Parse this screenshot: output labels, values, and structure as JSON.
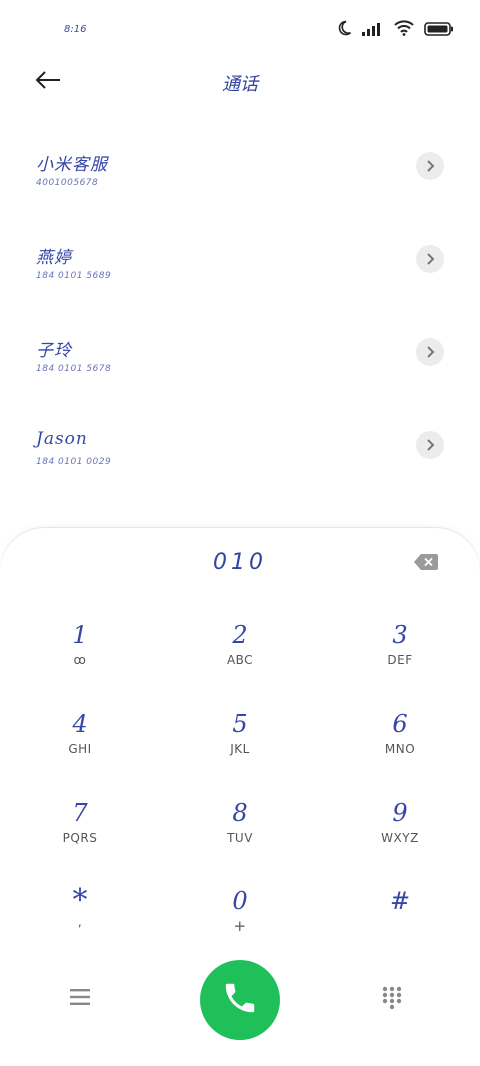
{
  "status_bar": {
    "time": "8:16"
  },
  "header": {
    "title": "通话"
  },
  "contacts": [
    {
      "name": "小米客服",
      "number": "4001005678"
    },
    {
      "name": "燕婷",
      "number": "184 0101 5689"
    },
    {
      "name": "子玲",
      "number": "184 0101 5678"
    },
    {
      "name": "Jason",
      "number": "184 0101 0029"
    }
  ],
  "dialpad": {
    "display": "010",
    "keys": [
      {
        "digit": "1",
        "letters": "ꝏ"
      },
      {
        "digit": "2",
        "letters": "ABC"
      },
      {
        "digit": "3",
        "letters": "DEF"
      },
      {
        "digit": "4",
        "letters": "GHI"
      },
      {
        "digit": "5",
        "letters": "JKL"
      },
      {
        "digit": "6",
        "letters": "MNO"
      },
      {
        "digit": "7",
        "letters": "PQRS"
      },
      {
        "digit": "8",
        "letters": "TUV"
      },
      {
        "digit": "9",
        "letters": "WXYZ"
      },
      {
        "digit": "*",
        "letters": ","
      },
      {
        "digit": "0",
        "letters": "+"
      },
      {
        "digit": "#",
        "letters": ""
      }
    ]
  },
  "colors": {
    "call_button": "#1fbf59",
    "handwriting": "#3446a8"
  }
}
